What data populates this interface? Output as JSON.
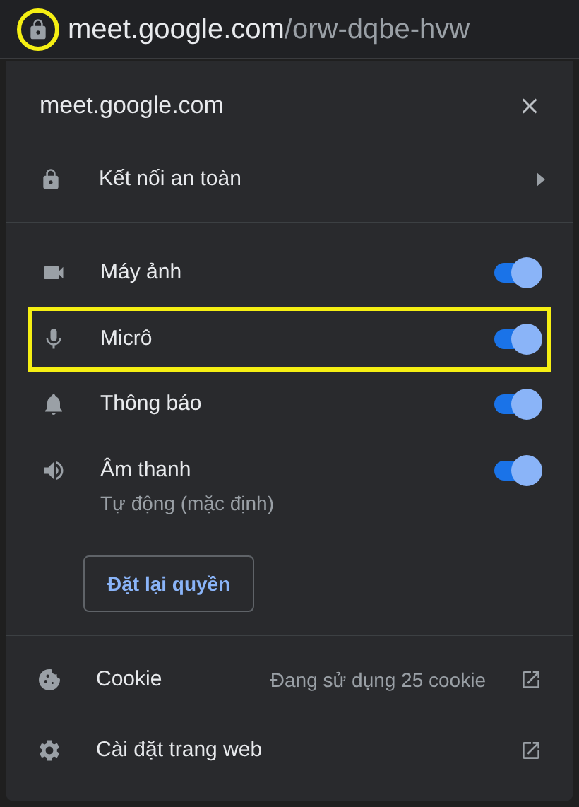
{
  "address_bar": {
    "domain": "meet.google.com",
    "path": "/orw-dqbe-hvw",
    "lock_highlighted": true
  },
  "popup": {
    "title": "meet.google.com",
    "connection": {
      "label": "Kết nối an toàn"
    },
    "permissions": [
      {
        "label": "Máy ảnh",
        "on": true,
        "highlighted": false
      },
      {
        "label": "Micrô",
        "on": true,
        "highlighted": true
      },
      {
        "label": "Thông báo",
        "on": true,
        "highlighted": false
      },
      {
        "label": "Âm thanh",
        "sublabel": "Tự động (mặc định)",
        "on": true,
        "highlighted": false
      }
    ],
    "reset_button": "Đặt lại quyền",
    "links": [
      {
        "label": "Cookie",
        "detail": "Đang sử dụng 25 cookie"
      },
      {
        "label": "Cài đặt trang web"
      }
    ]
  }
}
